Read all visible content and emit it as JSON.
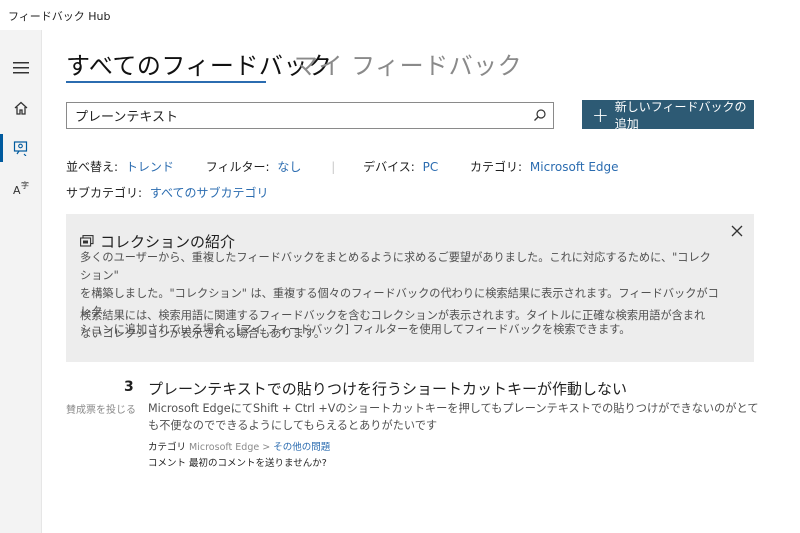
{
  "window": {
    "title": "フィードバック Hub"
  },
  "nav": {
    "items": [
      {
        "name": "menu"
      },
      {
        "name": "home"
      },
      {
        "name": "feedback",
        "active": true
      },
      {
        "name": "language"
      }
    ]
  },
  "tabs": [
    {
      "label": "すべてのフィードバック",
      "active": true
    },
    {
      "label": "マイ フィードバック",
      "active": false
    }
  ],
  "search": {
    "value": "プレーンテキスト"
  },
  "add_button": {
    "label": "新しいフィードバックの追加"
  },
  "filters": {
    "sort_label": "並べ替え:",
    "sort_value": "トレンド",
    "filter_label": "フィルター:",
    "filter_value": "なし",
    "separator": "|",
    "device_label": "デバイス:",
    "device_value": "PC",
    "category_label": "カテゴリ:",
    "category_value": "Microsoft Edge",
    "subcategory_label": "サブカテゴリ:",
    "subcategory_value": "すべてのサブカテゴリ"
  },
  "notice": {
    "title": "コレクションの紹介",
    "p1_l1": "多くのユーザーから、重複したフィードバックをまとめるように求めるご要望がありました。これに対応するために、\"コレクション\"",
    "p1_l2": "を構築しました。\"コレクション\" は、重複する個々のフィードバックの代わりに検索結果に表示されます。フィードバックがコレク",
    "p1_l3": "ションに追加されている場合、[マイ フィードバック] フィルターを使用してフィードバックを検索できます。",
    "p2_l1": "検索結果には、検索用語に関連するフィードバックを含むコレクションが表示されます。タイトルに正確な検索用語が含まれ",
    "p2_l2": "ないコレクションが表示される場合もあります。"
  },
  "items": [
    {
      "votes": "3",
      "vote_label": "賛成票を投じる",
      "title": "プレーンテキストでの貼りつけを行うショートカットキーが作動しない",
      "desc_l1": "Microsoft EdgeにてShift + Ctrl +Vのショートカットキーを押してもプレーンテキストでの貼りつけができないのがとて",
      "desc_l2": "も不便なのでできるようにしてもらえるとありがたいです",
      "category_label": "カテゴリ",
      "category_value": "Microsoft Edge",
      "category_arrow": ">",
      "category_sub": "その他の問題",
      "comment_label": "コメント",
      "comment_value": "最初のコメントを送りませんか?"
    }
  ],
  "colors": {
    "accent": "#2b6cb0",
    "button_bg": "#2d5a74",
    "notice_bg": "#ededed"
  }
}
